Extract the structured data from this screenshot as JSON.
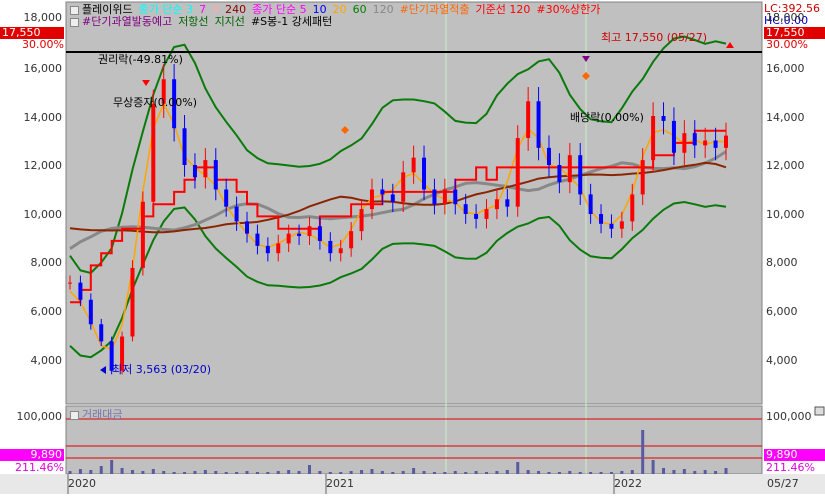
{
  "legend_main": {
    "row1": [
      {
        "text": "플레이위드",
        "color": "#000000"
      },
      {
        "text": "종가 단순 3",
        "color": "#00ffff"
      },
      {
        "text": "7",
        "color": "#ff00ff"
      },
      {
        "text": "9",
        "color": "#ffaaaa"
      },
      {
        "text": "240",
        "color": "#8b0000"
      },
      {
        "text": "종가 단순 5",
        "color": "#ff00ff"
      },
      {
        "text": "10",
        "color": "#0000ff"
      },
      {
        "text": "20",
        "color": "#ffa500"
      },
      {
        "text": "60",
        "color": "#008000"
      },
      {
        "text": "120",
        "color": "#888888"
      },
      {
        "text": "#단기과열적출",
        "color": "#ff6600"
      },
      {
        "text": "기준선 120",
        "color": "#ff0000"
      },
      {
        "text": "#30%상한가",
        "color": "#ff0000"
      }
    ],
    "row2": [
      {
        "text": "#단기과열발동예고",
        "color": "#800080"
      },
      {
        "text": "저항선",
        "color": "#006400"
      },
      {
        "text": "지지선",
        "color": "#006400"
      },
      {
        "text": "#S봉-1 강세패턴",
        "color": "#000000"
      }
    ]
  },
  "right_info": {
    "lc": "LC:392.56",
    "hc": "HC:0.00"
  },
  "badges": {
    "price": "17,550",
    "pct": "30.00%",
    "vol": "9,890",
    "vol_pct": "211.46%"
  },
  "annotations": {
    "high": "최고 17,550 (05/27)",
    "low": "최저 3,563 (03/20)",
    "rights": "권리락(-49.81%)",
    "free1": "무상증자(0.00%)",
    "free2": "배당락(0.00%)"
  },
  "volume_pane": {
    "title": "거래대금"
  },
  "price_axis": [
    "18,000",
    "16,000",
    "14,000",
    "12,000",
    "10,000",
    "8,000",
    "6,000",
    "4,000"
  ],
  "vol_axis": [
    "100,000"
  ],
  "time_axis": [
    "2020",
    "2021",
    "2022",
    "05/27"
  ],
  "colors": {
    "bg_plot": "#c0c0c0",
    "candle_up": "#ff0000",
    "candle_down": "#0000ff",
    "badge_red": "#e00000",
    "badge_magenta": "#ff00ff"
  },
  "chart_data": {
    "type": "line",
    "series": [
      {
        "values": [
          7200,
          6500,
          5500,
          4800,
          3600,
          5000,
          7800,
          10500,
          14500,
          15500,
          13500,
          12000,
          11500,
          12200,
          11000,
          10300,
          9700,
          9200,
          8700,
          8400,
          8800,
          9200,
          9100,
          9500,
          8900,
          8400,
          8600,
          9300,
          10200,
          11000,
          10800,
          10500,
          11700,
          12300,
          11000,
          10400,
          11000,
          10400,
          10000,
          9800,
          10200,
          10600,
          10300,
          13100,
          14600,
          12700,
          12000,
          11300,
          12400,
          10800,
          10000,
          9600,
          9400,
          9700,
          10800,
          12200,
          14000,
          13800,
          12500,
          13300,
          12800,
          13000,
          12700,
          13200
        ]
      }
    ],
    "ylim": [
      3000,
      18500
    ]
  }
}
